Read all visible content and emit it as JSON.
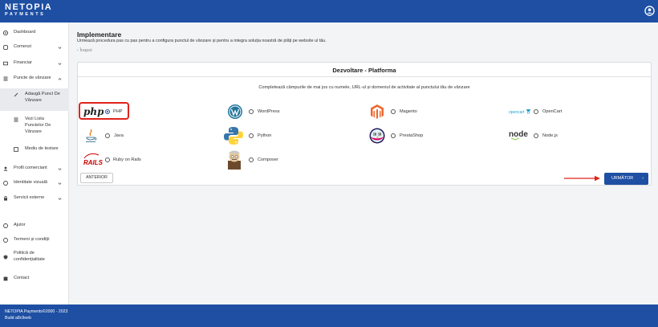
{
  "brand": {
    "line1": "NETOPIA",
    "line2": "PAYMENTS"
  },
  "sidebar": {
    "items": [
      {
        "label": "Dashboard",
        "icon": "dashboard-icon"
      },
      {
        "label": "Comenzi",
        "icon": "orders-icon",
        "expandable": true
      },
      {
        "label": "Financiar",
        "icon": "finance-icon",
        "expandable": true
      },
      {
        "label": "Puncte de vânzare",
        "icon": "list-icon",
        "expandable": true,
        "expanded": true
      }
    ],
    "sub_items": [
      {
        "label_1": "Adaugă Punct De",
        "label_2": "Vânzare",
        "icon": "add-point-icon",
        "active": true
      },
      {
        "label_1": "Vezi Lista",
        "label_2": "Punctelor De",
        "label_3": "Vânzare",
        "icon": "list-icon"
      },
      {
        "label_1": "Mediu de testare",
        "icon": "test-env-icon"
      }
    ],
    "items_2": [
      {
        "label": "Profil comerciant",
        "icon": "profile-icon",
        "expandable": true
      },
      {
        "label": "Identitate vizuală",
        "icon": "visual-identity-icon",
        "expandable": true
      },
      {
        "label": "Servicii externe",
        "icon": "external-services-icon",
        "expandable": true
      }
    ],
    "bottom": [
      {
        "label": "Ajutor",
        "icon": "help-icon"
      },
      {
        "label": "Termeni și condiții",
        "icon": "terms-icon"
      },
      {
        "label_1": "Politică de",
        "label_2": "confidențialitate",
        "icon": "privacy-icon"
      },
      {
        "label": "Contact",
        "icon": "contact-icon"
      }
    ]
  },
  "page": {
    "title": "Implementare",
    "description": "Urmează procedura pas cu pas pentru a configura punctul de vânzare și pentru a integra soluția noastră de plăți pe website ul tău.",
    "back": "Înapoi"
  },
  "card": {
    "title": "Dezvoltare - Platforma",
    "instructions": "Completează câmpurile de mai jos cu numele, URL-ul și domeniul de activitate al punctului tău de vânzare",
    "options": [
      {
        "label": "PHP",
        "logo": "php",
        "selected": true
      },
      {
        "label": "WordPress",
        "logo": "wordpress"
      },
      {
        "label": "Magento",
        "logo": "magento"
      },
      {
        "label": "OpenCart",
        "logo": "opencart"
      },
      {
        "label": "Java",
        "logo": "java"
      },
      {
        "label": "Python",
        "logo": "python"
      },
      {
        "label": "PrestaShop",
        "logo": "prestashop"
      },
      {
        "label": "Node.js",
        "logo": "nodejs"
      },
      {
        "label": "Ruby on Rails",
        "logo": "rails"
      },
      {
        "label": "Composer",
        "logo": "composer"
      }
    ],
    "logo_text": {
      "php": "php",
      "opencart": "opencart",
      "node": "node",
      "rails": "RAILS"
    },
    "prev_button": "ANTERIOR",
    "next_button": "URMĂTOR",
    "next_arrow": "›"
  },
  "footer": {
    "line1": "NETOPIA Payments©2000 - 2023",
    "line2": "Build a8c9eeb"
  },
  "colors": {
    "brand_blue": "#1e4fa3",
    "highlight_red": "#e0231c"
  }
}
